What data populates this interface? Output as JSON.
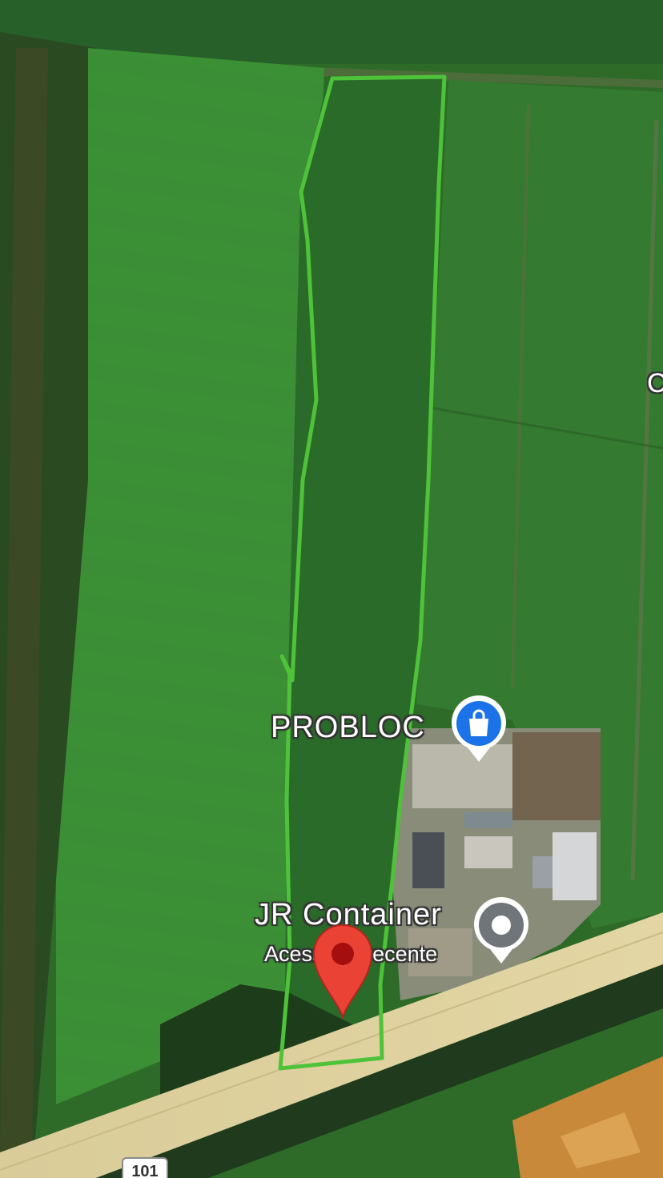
{
  "map": {
    "type": "satellite",
    "places": [
      {
        "name": "PROBLOC",
        "category_icon": "shopping-bag-icon",
        "accent": "#1a73e8"
      },
      {
        "name": "JR Container",
        "subtitle": "Acessado recente",
        "category_icon": "place-dot-icon",
        "accent": "#70757a"
      }
    ],
    "selected_pin": {
      "icon": "red-location-pin-icon",
      "color": "#ea4335"
    },
    "route_shield": {
      "label": "101"
    },
    "edge_label": {
      "text": "C"
    },
    "annotation": {
      "type": "freehand-outline",
      "color": "#4ec33a"
    }
  }
}
